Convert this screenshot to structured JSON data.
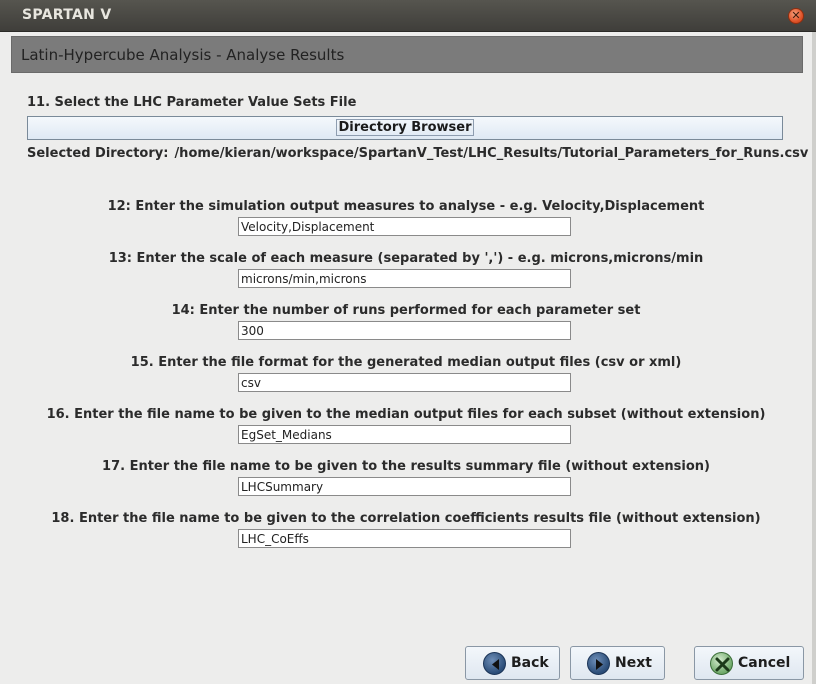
{
  "window": {
    "title": "SPARTAN V",
    "close_glyph": "✕"
  },
  "header": {
    "title": "Latin-Hypercube Analysis - Analyse Results"
  },
  "step11": {
    "label": "11. Select the LHC Parameter Value Sets File",
    "button_label": "Directory Browser",
    "selected_prefix": "Selected Directory:",
    "selected_path": "/home/kieran/workspace/SpartanV_Test/LHC_Results/Tutorial_Parameters_for_Runs.csv"
  },
  "questions": [
    {
      "label": "12: Enter the simulation output measures to analyse - e.g. Velocity,Displacement",
      "value": "Velocity,Displacement"
    },
    {
      "label": "13: Enter the scale of each measure (separated by ',') - e.g. microns,microns/min",
      "value": "microns/min,microns"
    },
    {
      "label": "14: Enter the number of runs performed for each parameter set",
      "value": "300"
    },
    {
      "label": "15. Enter the file format for the generated median output files (csv or xml)",
      "value": "csv"
    },
    {
      "label": "16. Enter the file name to be given to the median output files for each subset (without extension)",
      "value": "EgSet_Medians"
    },
    {
      "label": "17. Enter the file name to be given to the results summary file (without extension)",
      "value": "LHCSummary"
    },
    {
      "label": "18. Enter the file name to be given to the correlation coefficients results file (without extension)",
      "value": "LHC_CoEffs"
    }
  ],
  "footer": {
    "back_label": "Back",
    "next_label": "Next",
    "cancel_label": "Cancel",
    "back_icon": "arrow-left-icon",
    "next_icon": "arrow-right-icon",
    "cancel_icon": "x-icon"
  }
}
